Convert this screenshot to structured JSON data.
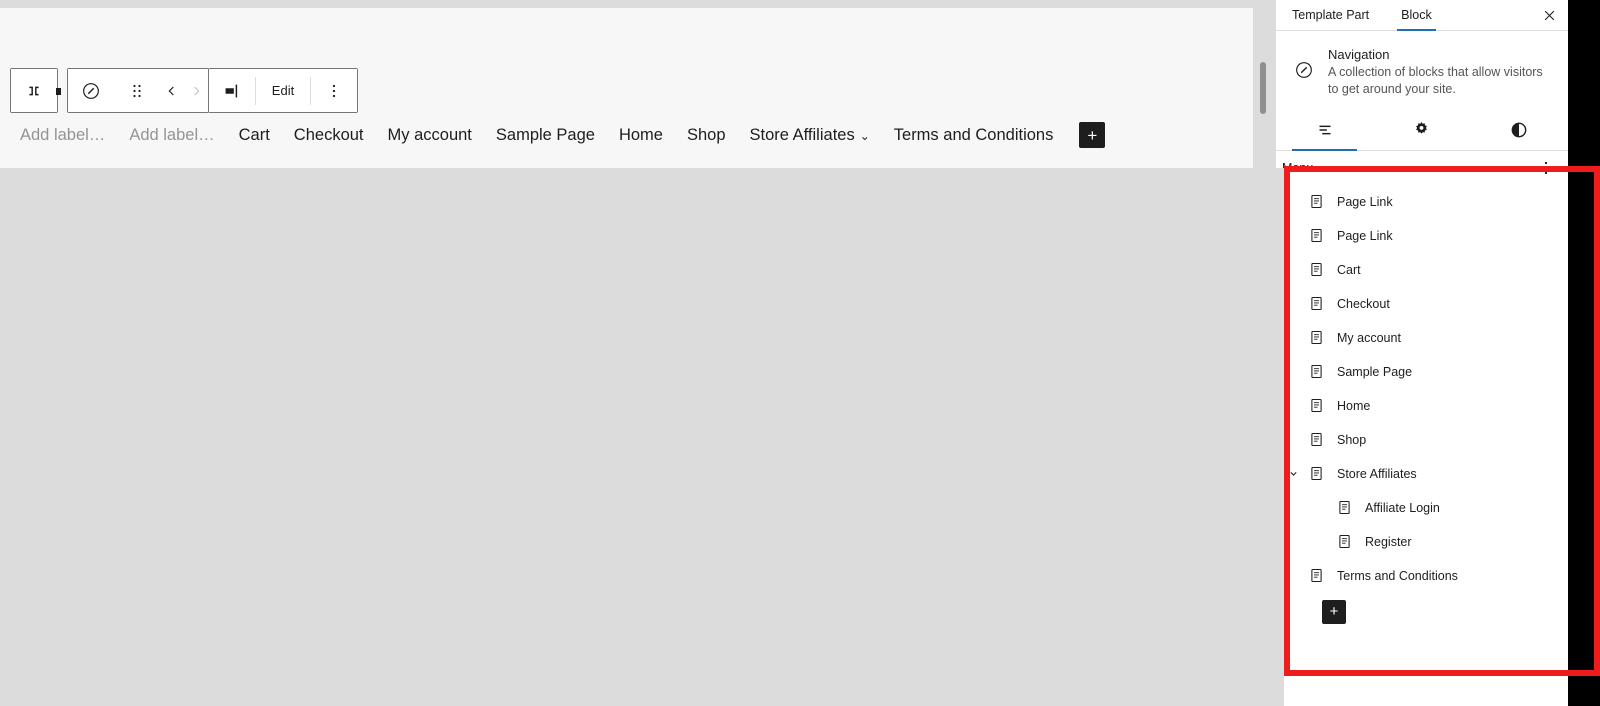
{
  "editor": {
    "toolbar": {
      "align_icon": "justify-items-icon",
      "block_type_icon": "navigation-compass-icon",
      "drag_icon": "drag-handle-icon",
      "move_up_icon": "chevron-left-icon",
      "move_down_icon": "chevron-right-icon",
      "text_cursor_icon": "select-block-icon",
      "edit_label": "Edit",
      "options_icon": "more-vertical-icon"
    },
    "nav_preview": {
      "items": [
        {
          "label": "Add label…",
          "placeholder": true,
          "submenu": false
        },
        {
          "label": "Add label…",
          "placeholder": true,
          "submenu": false
        },
        {
          "label": "Cart",
          "placeholder": false,
          "submenu": false
        },
        {
          "label": "Checkout",
          "placeholder": false,
          "submenu": false
        },
        {
          "label": "My account",
          "placeholder": false,
          "submenu": false
        },
        {
          "label": "Sample Page",
          "placeholder": false,
          "submenu": false
        },
        {
          "label": "Home",
          "placeholder": false,
          "submenu": false
        },
        {
          "label": "Shop",
          "placeholder": false,
          "submenu": false
        },
        {
          "label": "Store Affiliates",
          "placeholder": false,
          "submenu": true
        },
        {
          "label": "Terms and Conditions",
          "placeholder": false,
          "submenu": false
        }
      ],
      "add_button_label": "+",
      "add_button_icon": "plus-icon"
    }
  },
  "sidebar": {
    "tabs": [
      {
        "label": "Template Part",
        "active": false
      },
      {
        "label": "Block",
        "active": true
      }
    ],
    "close_icon": "close-icon",
    "block_card": {
      "icon": "navigation-compass-icon",
      "title": "Navigation",
      "description": "A collection of blocks that allow visitors to get around your site."
    },
    "icon_tabs": [
      {
        "name": "list-view-icon",
        "active": true
      },
      {
        "name": "gear-icon",
        "active": false
      },
      {
        "name": "styles-contrast-icon",
        "active": false
      }
    ],
    "list_view": {
      "header_label": "Menu",
      "header_options_icon": "more-vertical-icon",
      "rows": [
        {
          "label": "Page Link",
          "icon": "page-icon",
          "depth": 1,
          "expander": "none"
        },
        {
          "label": "Page Link",
          "icon": "page-icon",
          "depth": 1,
          "expander": "none"
        },
        {
          "label": "Cart",
          "icon": "page-icon",
          "depth": 1,
          "expander": "none"
        },
        {
          "label": "Checkout",
          "icon": "page-icon",
          "depth": 1,
          "expander": "none"
        },
        {
          "label": "My account",
          "icon": "page-icon",
          "depth": 1,
          "expander": "none"
        },
        {
          "label": "Sample Page",
          "icon": "page-icon",
          "depth": 1,
          "expander": "none"
        },
        {
          "label": "Home",
          "icon": "page-icon",
          "depth": 1,
          "expander": "none"
        },
        {
          "label": "Shop",
          "icon": "page-icon",
          "depth": 1,
          "expander": "none"
        },
        {
          "label": "Store Affiliates",
          "icon": "page-icon",
          "depth": 1,
          "expander": "expanded"
        },
        {
          "label": "Affiliate Login",
          "icon": "page-icon",
          "depth": 2,
          "expander": "none"
        },
        {
          "label": "Register",
          "icon": "page-icon",
          "depth": 2,
          "expander": "none"
        },
        {
          "label": "Terms and Conditions",
          "icon": "page-icon",
          "depth": 1,
          "expander": "none"
        }
      ],
      "appender_label": "+",
      "appender_icon": "plus-icon"
    }
  },
  "annotation": {
    "highlight_color": "#ee1c1c",
    "accent_color": "#1e6fb8"
  }
}
